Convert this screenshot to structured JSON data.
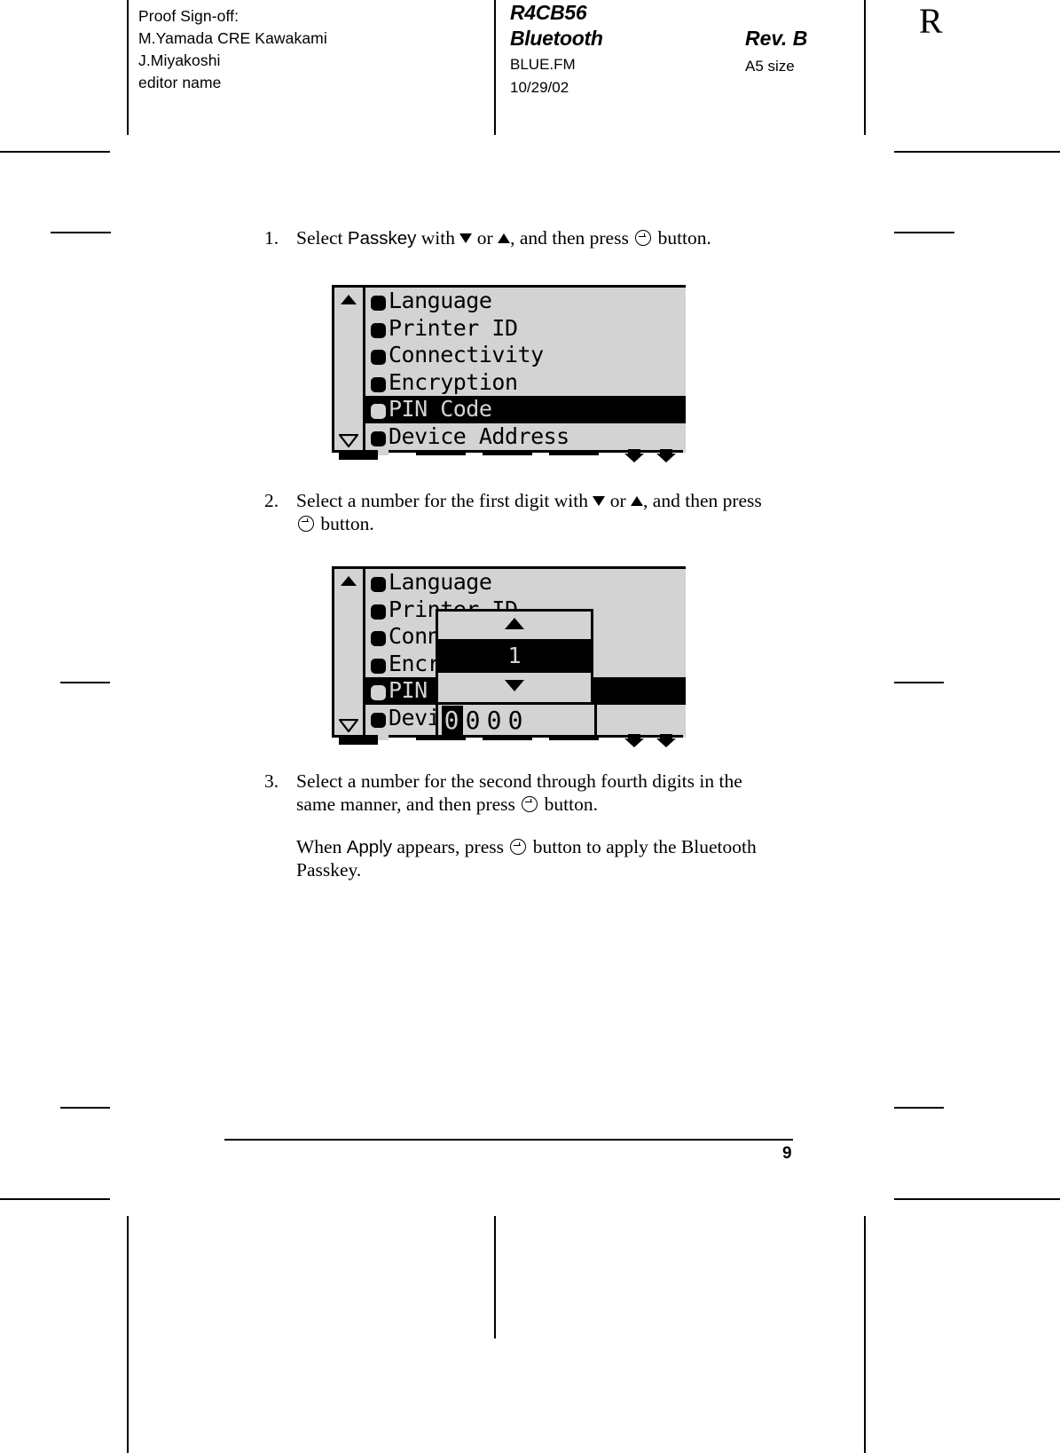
{
  "header": {
    "proof_signoff": [
      "Proof Sign-off:",
      "M.Yamada CRE Kawakami",
      "J.Miyakoshi",
      "editor name"
    ],
    "doc_code": "R4CB56",
    "doc_name": "Bluetooth",
    "file_name": "BLUE.FM",
    "date": "10/29/02",
    "revision": "Rev. B",
    "paper_size": "A5 size",
    "rev_mark": "R"
  },
  "steps": [
    {
      "number": "1.",
      "parts": [
        {
          "type": "text",
          "value": "Select "
        },
        {
          "type": "sans",
          "value": "Passkey"
        },
        {
          "type": "text",
          "value": " with "
        },
        {
          "type": "icon",
          "value": "triangle-down-icon"
        },
        {
          "type": "text",
          "value": " or "
        },
        {
          "type": "icon",
          "value": "triangle-up-icon"
        },
        {
          "type": "text",
          "value": ", and then press "
        },
        {
          "type": "icon",
          "value": "enter-button-icon"
        },
        {
          "type": "text",
          "value": " button."
        }
      ]
    },
    {
      "number": "2.",
      "parts": [
        {
          "type": "text",
          "value": "Select a number for the first digit with "
        },
        {
          "type": "icon",
          "value": "triangle-down-icon"
        },
        {
          "type": "text",
          "value": " or "
        },
        {
          "type": "icon",
          "value": "triangle-up-icon"
        },
        {
          "type": "text",
          "value": ", and then press"
        },
        {
          "type": "break",
          "value": ""
        },
        {
          "type": "icon",
          "value": "enter-button-icon"
        },
        {
          "type": "text",
          "value": " button."
        }
      ]
    },
    {
      "number": "3.",
      "parts": [
        {
          "type": "text",
          "value": "Select a number for the second through fourth digits in the"
        },
        {
          "type": "break",
          "value": ""
        },
        {
          "type": "text",
          "value": "same manner, and then press "
        },
        {
          "type": "icon",
          "value": "enter-button-icon"
        },
        {
          "type": "text",
          "value": " button."
        }
      ]
    }
  ],
  "note_paragraph": {
    "parts": [
      {
        "type": "text",
        "value": "When "
      },
      {
        "type": "sans",
        "value": "Apply"
      },
      {
        "type": "text",
        "value": " appears, press "
      },
      {
        "type": "icon",
        "value": "enter-button-icon"
      },
      {
        "type": "text",
        "value": " button to apply the Bluetooth"
      },
      {
        "type": "break",
        "value": ""
      },
      {
        "type": "text",
        "value": "Passkey."
      }
    ]
  },
  "lcd_figure_1": {
    "name": "bluetooth-settings-menu",
    "scroll_up_indicator": "scroll-up-arrow",
    "scroll_down_indicator": "scroll-down-arrow",
    "menu_items": [
      {
        "label": "Language",
        "selected": false
      },
      {
        "label": "Printer ID",
        "selected": false
      },
      {
        "label": "Connectivity",
        "selected": false
      },
      {
        "label": "Encryption",
        "selected": false
      },
      {
        "label": "PIN Code",
        "selected": true
      },
      {
        "label": "Device Address",
        "selected": false
      }
    ]
  },
  "lcd_figure_2": {
    "name": "pin-code-entry-dialog",
    "scroll_up_indicator": "scroll-up-arrow",
    "scroll_down_indicator": "scroll-down-arrow",
    "menu_items": [
      {
        "label": "Language",
        "selected": false
      },
      {
        "label": "Printer ID",
        "selected": false
      },
      {
        "label": "Connectivity",
        "selected": false
      },
      {
        "label": "Encryption",
        "selected": false
      },
      {
        "label": "PIN Code",
        "selected": true
      },
      {
        "label": "Device Address",
        "selected": false
      }
    ],
    "spinner": {
      "up_arrow": "spinner-up-arrow",
      "value": "1",
      "down_arrow": "spinner-down-arrow"
    },
    "pin_digits": [
      {
        "value": "0",
        "selected": true
      },
      {
        "value": "0",
        "selected": false
      },
      {
        "value": "0",
        "selected": false
      },
      {
        "value": "0",
        "selected": false
      }
    ]
  },
  "footer": {
    "page_number": "9"
  },
  "colors": {
    "lcd_background": "#d3d3d3",
    "lcd_foreground": "#000000",
    "page_background": "#ffffff"
  }
}
